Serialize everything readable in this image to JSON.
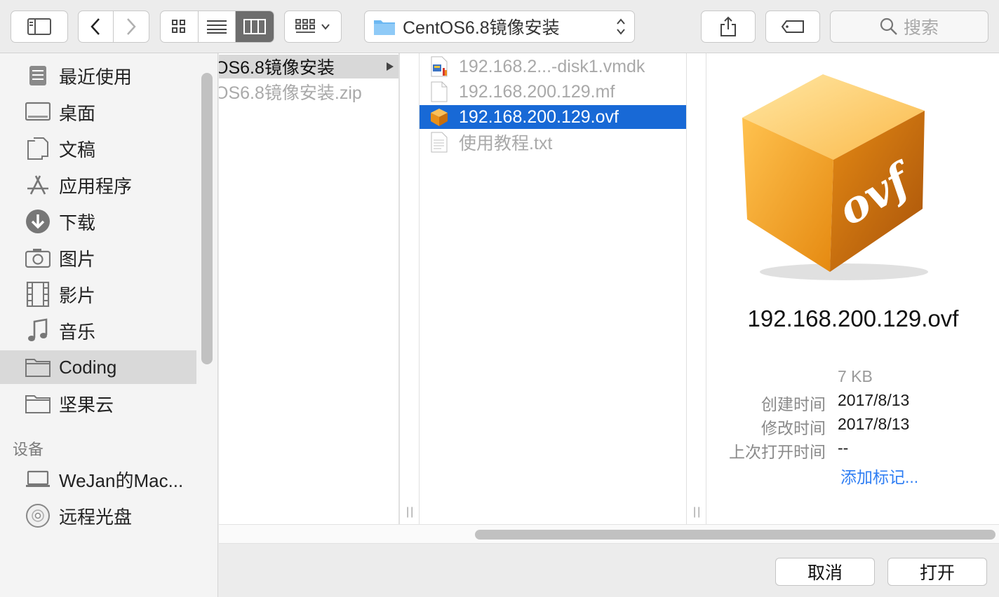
{
  "toolbar": {
    "path_label": "CentOS6.8镜像安装",
    "search_placeholder": "搜索"
  },
  "sidebar": {
    "favorites": [
      {
        "label": "最近使用",
        "icon": "recents-icon"
      },
      {
        "label": "桌面",
        "icon": "desktop-icon"
      },
      {
        "label": "文稿",
        "icon": "documents-icon"
      },
      {
        "label": "应用程序",
        "icon": "applications-icon"
      },
      {
        "label": "下载",
        "icon": "downloads-icon"
      },
      {
        "label": "图片",
        "icon": "pictures-icon"
      },
      {
        "label": "影片",
        "icon": "movies-icon"
      },
      {
        "label": "音乐",
        "icon": "music-icon"
      },
      {
        "label": "Coding",
        "icon": "folder-icon",
        "selected": true
      },
      {
        "label": "坚果云",
        "icon": "folder-icon"
      }
    ],
    "devices_header": "设备",
    "devices": [
      {
        "label": "WeJan的Mac...",
        "icon": "laptop-icon"
      },
      {
        "label": "远程光盘",
        "icon": "disc-icon"
      }
    ]
  },
  "columns": {
    "col1": [
      {
        "label": "OS6.8镜像安装",
        "selected": true
      },
      {
        "label": "OS6.8镜像安装.zip",
        "dim": true
      }
    ],
    "col2": [
      {
        "label": "192.168.2...-disk1.vmdk",
        "dim": true,
        "icon": "vmdk-file-icon"
      },
      {
        "label": "192.168.200.129.mf",
        "dim": true,
        "icon": "document-file-icon"
      },
      {
        "label": "192.168.200.129.ovf",
        "selected": true,
        "icon": "ovf-file-icon"
      },
      {
        "label": "使用教程.txt",
        "dim": true,
        "icon": "text-file-icon"
      }
    ]
  },
  "preview": {
    "icon_text": "ovf",
    "file_name": "192.168.200.129.ovf",
    "size": "7 KB",
    "created_label": "创建时间",
    "created_value": "2017/8/13",
    "modified_label": "修改时间",
    "modified_value": "2017/8/13",
    "opened_label": "上次打开时间",
    "opened_value": "--",
    "add_tags": "添加标记..."
  },
  "buttons": {
    "cancel": "取消",
    "open": "打开"
  },
  "colors": {
    "selection_blue": "#1869d6",
    "link_blue": "#2f7ef3",
    "ovf_orange": "#f39a1c"
  }
}
